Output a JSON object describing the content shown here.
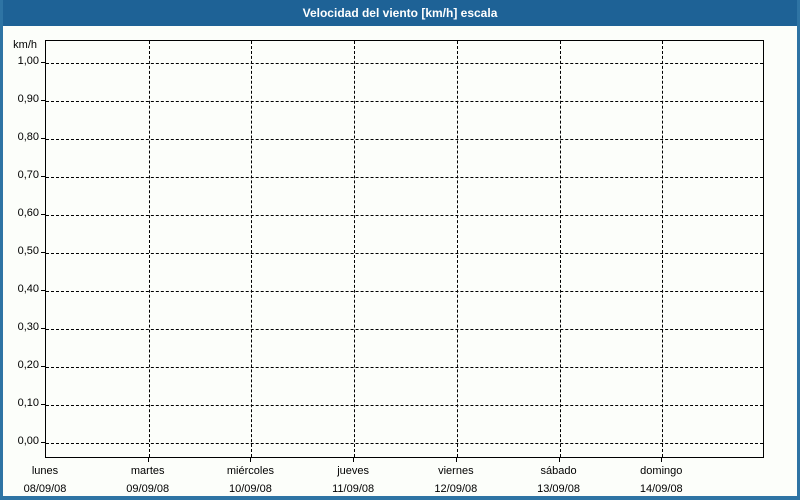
{
  "window": {
    "title": "Velocidad del viento [km/h] escala"
  },
  "chart_data": {
    "type": "line",
    "title": "Velocidad del viento [km/h] escala",
    "ylabel": "km/h",
    "xlabel": "",
    "ylim": [
      0.0,
      1.0
    ],
    "y_tick_step": 0.1,
    "y_tick_labels": [
      "1,00",
      "0,90",
      "0,80",
      "0,70",
      "0,60",
      "0,50",
      "0,40",
      "0,30",
      "0,20",
      "0,10",
      "0,00"
    ],
    "days": [
      {
        "name": "lunes",
        "date": "08/09/08"
      },
      {
        "name": "martes",
        "date": "09/09/08"
      },
      {
        "name": "miércoles",
        "date": "10/09/08"
      },
      {
        "name": "jueves",
        "date": "11/09/08"
      },
      {
        "name": "viernes",
        "date": "12/09/08"
      },
      {
        "name": "sábado",
        "date": "13/09/08"
      },
      {
        "name": "domingo",
        "date": "14/09/08"
      }
    ],
    "grid": "dashed",
    "legend": "none",
    "series": []
  },
  "colors": {
    "header_bg": "#1e6296",
    "frame_border": "#2e74a4",
    "background": "#fcfefa",
    "grid": "#000000",
    "text": "#000000",
    "title_text": "#ffffff"
  }
}
